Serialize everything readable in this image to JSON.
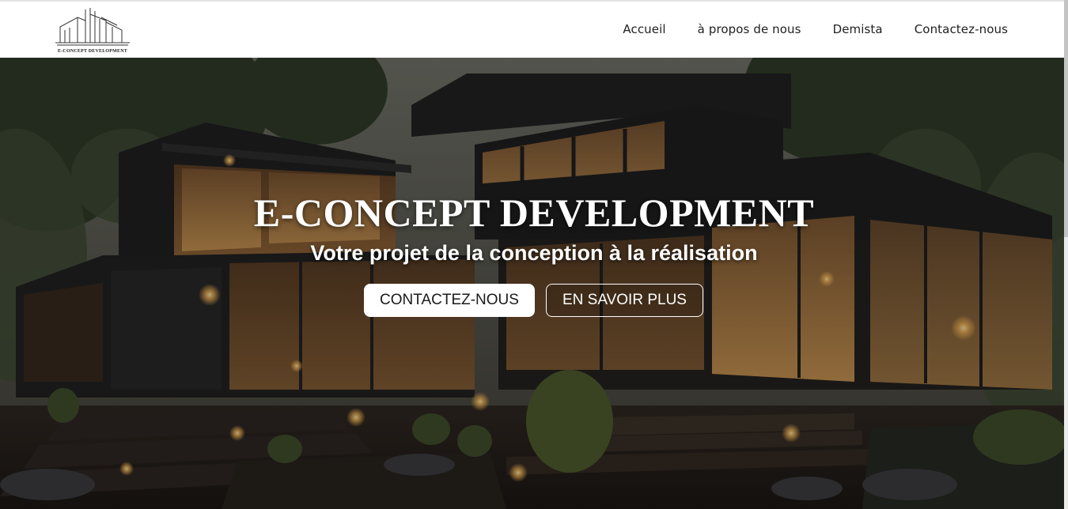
{
  "brand": {
    "logo_text": "E-CONCEPT DEVELOPMENT",
    "logo_icon": "building-outline-logo"
  },
  "nav": {
    "items": [
      {
        "label": "Accueil"
      },
      {
        "label": "à propos de nous"
      },
      {
        "label": "Demista"
      },
      {
        "label": "Contactez-nous"
      }
    ]
  },
  "hero": {
    "title": "E-CONCEPT DEVELOPMENT",
    "subtitle": "Votre projet de la conception à la réalisation",
    "primary_button": "CONTACTEZ-NOUS",
    "secondary_button": "EN SAVOIR PLUS",
    "background_image": "modern dark wood house at dusk"
  },
  "colors": {
    "header_bg": "#ffffff",
    "nav_text": "#1f1f1f",
    "hero_text": "#ffffff",
    "primary_button_bg": "#ffffff",
    "primary_button_text": "#1a1a1a",
    "secondary_button_border": "#ffffff"
  }
}
